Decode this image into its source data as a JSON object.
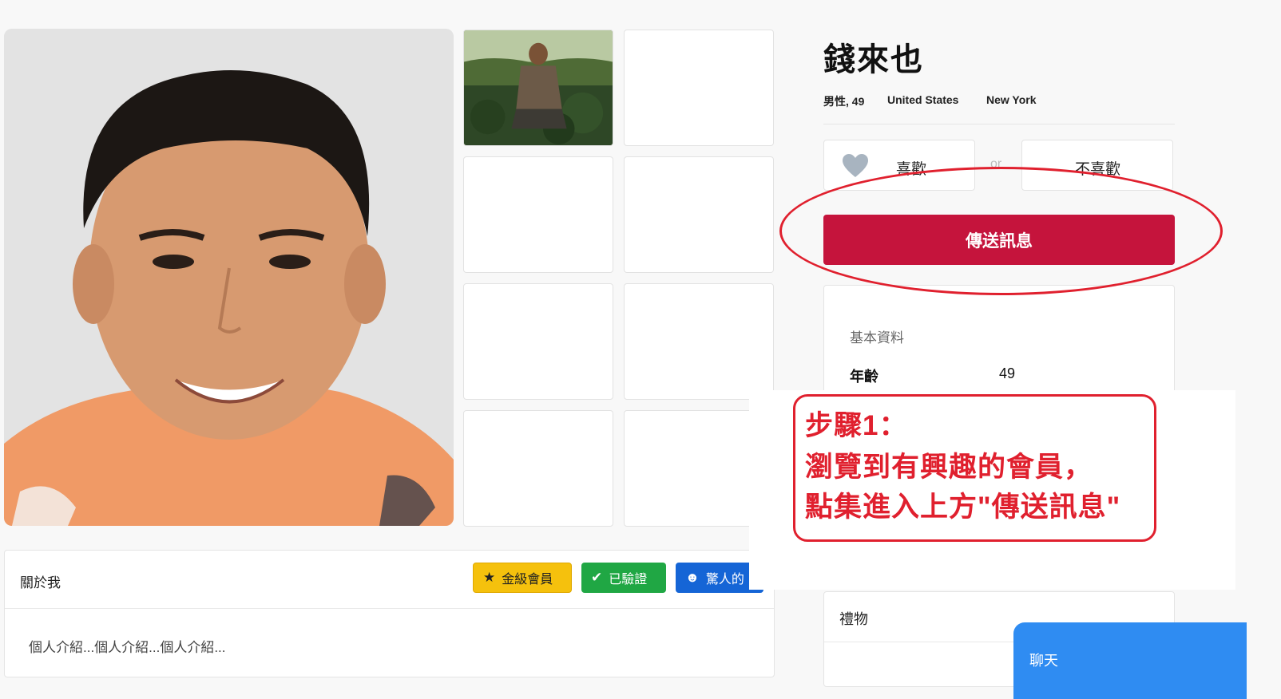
{
  "profile": {
    "name": "錢來也",
    "gender_age": "男性, 49",
    "country": "United States",
    "city": "New York"
  },
  "actions": {
    "like_label": "喜歡",
    "or_text": "or",
    "dislike_label": "不喜歡",
    "send_message_label": "傳送訊息"
  },
  "basic_info": {
    "heading": "基本資料",
    "rows": [
      {
        "key": "年齡",
        "value": "49"
      }
    ]
  },
  "about": {
    "title": "關於我",
    "badges": [
      {
        "label": "金級會員",
        "icon": "star-icon",
        "color": "#f5c10d"
      },
      {
        "label": "已驗證",
        "icon": "check-icon",
        "color": "#20a744"
      },
      {
        "label": "驚人的",
        "icon": "smile-icon",
        "color": "#1565d6"
      }
    ],
    "body": "個人介紹...個人介紹...個人介紹..."
  },
  "gifts": {
    "title": "禮物"
  },
  "chat": {
    "label": "聊天"
  },
  "annotation": {
    "lines": [
      "步驟1：",
      "瀏覽到有興趣的會員，",
      "點集進入上方\"傳送訊息\""
    ],
    "color": "#e0202e"
  },
  "colors": {
    "send_button": "#c5143c",
    "chat_tab": "#2f8cf2"
  }
}
